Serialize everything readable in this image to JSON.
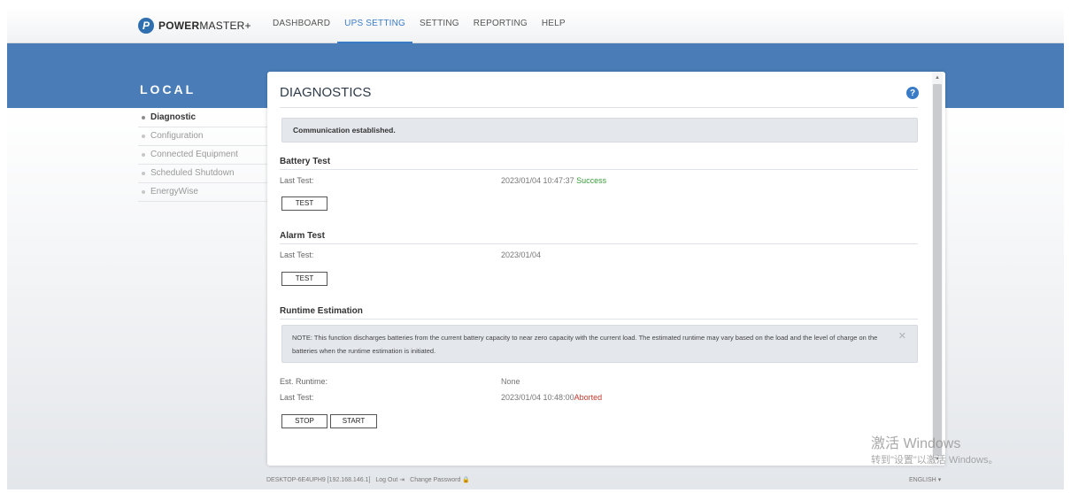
{
  "app": {
    "brand_bold": "POWER",
    "brand_rest": "MASTER+",
    "logo_glyph": "P"
  },
  "nav": {
    "tabs": [
      {
        "label": "DASHBOARD",
        "active": false
      },
      {
        "label": "UPS SETTING",
        "active": true
      },
      {
        "label": "SETTING",
        "active": false
      },
      {
        "label": "REPORTING",
        "active": false
      },
      {
        "label": "HELP",
        "active": false
      }
    ]
  },
  "sidebar": {
    "title": "LOCAL",
    "items": [
      {
        "label": "Diagnostic",
        "active": true
      },
      {
        "label": "Configuration",
        "active": false
      },
      {
        "label": "Connected Equipment",
        "active": false
      },
      {
        "label": "Scheduled Shutdown",
        "active": false
      },
      {
        "label": "EnergyWise",
        "active": false
      }
    ]
  },
  "panel": {
    "title": "DIAGNOSTICS",
    "help_glyph": "?",
    "communication": "Communication established.",
    "battery_test": {
      "title": "Battery Test",
      "last_label": "Last Test:",
      "last_value": "2023/01/04 10:47:37",
      "status": "Success",
      "button": "TEST"
    },
    "alarm_test": {
      "title": "Alarm Test",
      "last_label": "Last Test:",
      "last_value": "2023/01/04",
      "button": "TEST"
    },
    "runtime": {
      "title": "Runtime Estimation",
      "note": "NOTE: This function discharges batteries from the current battery capacity to near zero capacity with the current load. The estimated runtime may vary based on the load and the level of charge on the batteries when the runtime estimation is initiated.",
      "note_close": "✕",
      "est_label": "Est. Runtime:",
      "est_value": "None",
      "last_label": "Last Test:",
      "last_value": "2023/01/04 10:48:00",
      "status": "Aborted",
      "stop_button": "STOP",
      "start_button": "START"
    }
  },
  "footer": {
    "host": "DESKTOP-6E4UPH9 [192.168.146.1]",
    "logout": "Log Out",
    "logout_icon": "⇥",
    "change_password": "Change Password",
    "lock_icon": "🔒",
    "language": "ENGLISH",
    "language_caret": "▾"
  },
  "watermark": {
    "line1": "激活 Windows",
    "line2": "转到\"设置\"以激活 Windows。"
  },
  "colors": {
    "accent": "#3a7bc8",
    "band": "#4a7db8",
    "success": "#3a9a3a",
    "error": "#c0392b"
  }
}
